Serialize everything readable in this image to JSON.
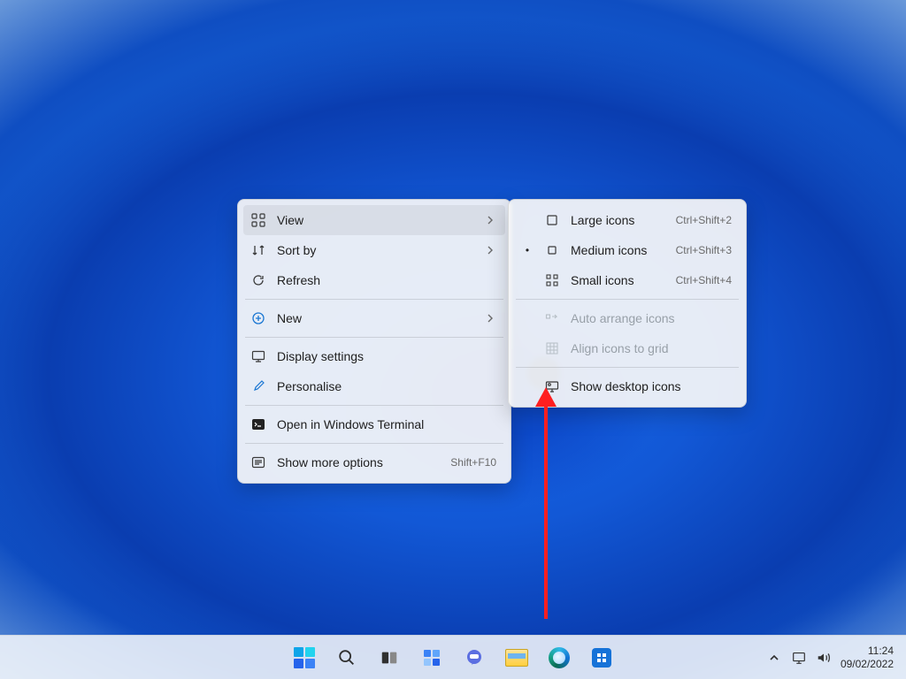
{
  "context_menu": {
    "items": [
      {
        "label": "View",
        "has_submenu": true,
        "hover": true,
        "icon": "view"
      },
      {
        "label": "Sort by",
        "has_submenu": true,
        "icon": "sort"
      },
      {
        "label": "Refresh",
        "icon": "refresh"
      }
    ],
    "new_label": "New",
    "display_settings_label": "Display settings",
    "personalise_label": "Personalise",
    "terminal_label": "Open in Windows Terminal",
    "more_options_label": "Show more options",
    "more_options_shortcut": "Shift+F10"
  },
  "view_submenu": {
    "large": {
      "label": "Large icons",
      "shortcut": "Ctrl+Shift+2"
    },
    "medium": {
      "label": "Medium icons",
      "shortcut": "Ctrl+Shift+3",
      "selected": true
    },
    "small": {
      "label": "Small icons",
      "shortcut": "Ctrl+Shift+4"
    },
    "auto_arrange": {
      "label": "Auto arrange icons",
      "disabled": true
    },
    "align_grid": {
      "label": "Align icons to grid",
      "disabled": true
    },
    "show_desktop": {
      "label": "Show desktop icons",
      "highlighted": true
    }
  },
  "taskbar": {
    "start": "Start",
    "search": "Search",
    "taskview": "Task view",
    "widgets": "Widgets",
    "chat": "Chat",
    "explorer": "File Explorer",
    "edge": "Microsoft Edge",
    "store": "Microsoft Store"
  },
  "systray": {
    "overflow": "Show hidden icons",
    "network_tip": "Network",
    "volume_tip": "Volume",
    "time": "11:24",
    "date": "09/02/2022"
  },
  "annotation": {
    "target": "Show desktop icons"
  }
}
